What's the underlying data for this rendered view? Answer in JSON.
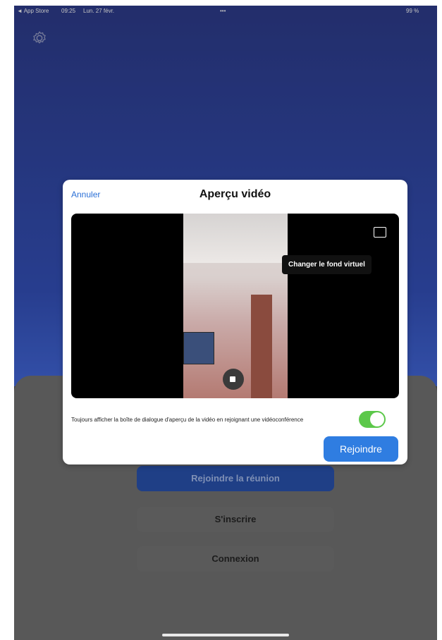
{
  "status_bar": {
    "app_store": "◄ App Store",
    "time": "09:25",
    "date": "Lun. 27 févr.",
    "dots": "•••",
    "battery": "99 %"
  },
  "background": {
    "logo": "zoom",
    "buttons": [
      "Rejoindre la réunion",
      "S'inscrire",
      "Connexion"
    ]
  },
  "dialog": {
    "cancel": "Annuler",
    "title": "Aperçu vidéo",
    "tooltip": "Changer le fond virtuel",
    "preference_label": "Toujours afficher la boîte de dialogue d'aperçu de la vidéo en rejoignant une vidéoconférence",
    "preference_on": true,
    "join_button": "Rejoindre"
  },
  "icons": {
    "settings": "gear-icon",
    "virtual_background": "image-icon",
    "camera": "video-camera-icon"
  },
  "colors": {
    "accent": "#2f7de1",
    "toggle_on": "#5cc84a",
    "link": "#2a6fd6"
  }
}
